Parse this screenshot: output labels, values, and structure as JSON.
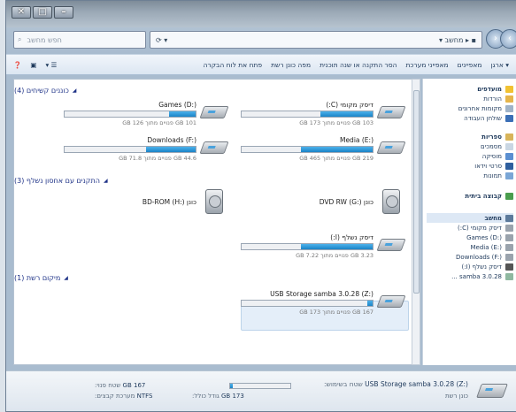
{
  "window": {
    "min": "–",
    "max": "□",
    "close": "✕"
  },
  "search": {
    "placeholder": "חפש מחשב"
  },
  "address": {
    "path": "מחשב",
    "arrow": "▾"
  },
  "toolbar": {
    "items": [
      "ארגן ▾",
      "מאפיינים",
      "מאפייני מערכת",
      "הסר התקנה או שנה תוכנית",
      "מפה כונן רשת",
      "פתח את לוח הבקרה"
    ],
    "right_icons": [
      "help-icon",
      "preview-pane-icon",
      "views-icon"
    ]
  },
  "groups": {
    "hdd": "כוננים קשיחים (4)",
    "removable": "התקנים עם אחסון נשלף (3)",
    "network": "מיקום רשת (1)"
  },
  "drives": [
    {
      "name": "דיסק מקומי (C:)",
      "free": "103 GB פנויים מתוך 173 GB",
      "fill": 0.4
    },
    {
      "name": "Games (D:)",
      "free": "101 GB פנויים מתוך 126 GB",
      "fill": 0.2
    },
    {
      "name": "Media (E:)",
      "free": "219 GB פנויים מתוך 465 GB",
      "fill": 0.55
    },
    {
      "name": "Downloads (F:)",
      "free": "44.6 GB פנויים מתוך 71.8 GB",
      "fill": 0.38
    },
    {
      "name": "כונן DVD RW (G:)",
      "free": "",
      "fill": 0
    },
    {
      "name": "כונן BD-ROM (H:)",
      "free": "",
      "fill": 0
    },
    {
      "name": "דיסק נשלף (I:)",
      "free": "3.23 GB פנויים מתוך 7.22 GB",
      "fill": 0.55
    },
    {
      "name": "USB Storage samba 3.0.28 (Z:)",
      "free": "167 GB פנויים מתוך 173 GB",
      "fill": 0.04
    }
  ],
  "nav": {
    "favorites": "מועדפים",
    "fav_items": [
      "הורדות",
      "מקומות אחרונים",
      "שולחן העבודה"
    ],
    "libraries": "ספריות",
    "lib_items": [
      "מסמכים",
      "מוסיקה",
      "סרטי וידאו",
      "תמונות"
    ],
    "homegroup": "קבוצה ביתית",
    "computer": "מחשב",
    "comp_items": [
      "דיסק מקומי (C:)",
      "Games (D:)",
      "Media (E:)",
      "Downloads (F:)",
      "דיסק נשלף (I:)",
      "samba 3.0.28 ..."
    ]
  },
  "status": {
    "name": "USB Storage samba 3.0.28 (Z:)",
    "type": "כונן רשת",
    "space_used_label": "שטח בשימוש:",
    "space_free_label": "שטח פנוי:",
    "total_label": "גודל כולל:",
    "free_value": "167 GB",
    "total_value": "173 GB",
    "fs_label": "מערכת קבצים:",
    "fs_value": "NTFS",
    "used_fill": 0.04
  },
  "colors": {
    "accent": "#1b83c6",
    "group_title": "#1e3287"
  }
}
